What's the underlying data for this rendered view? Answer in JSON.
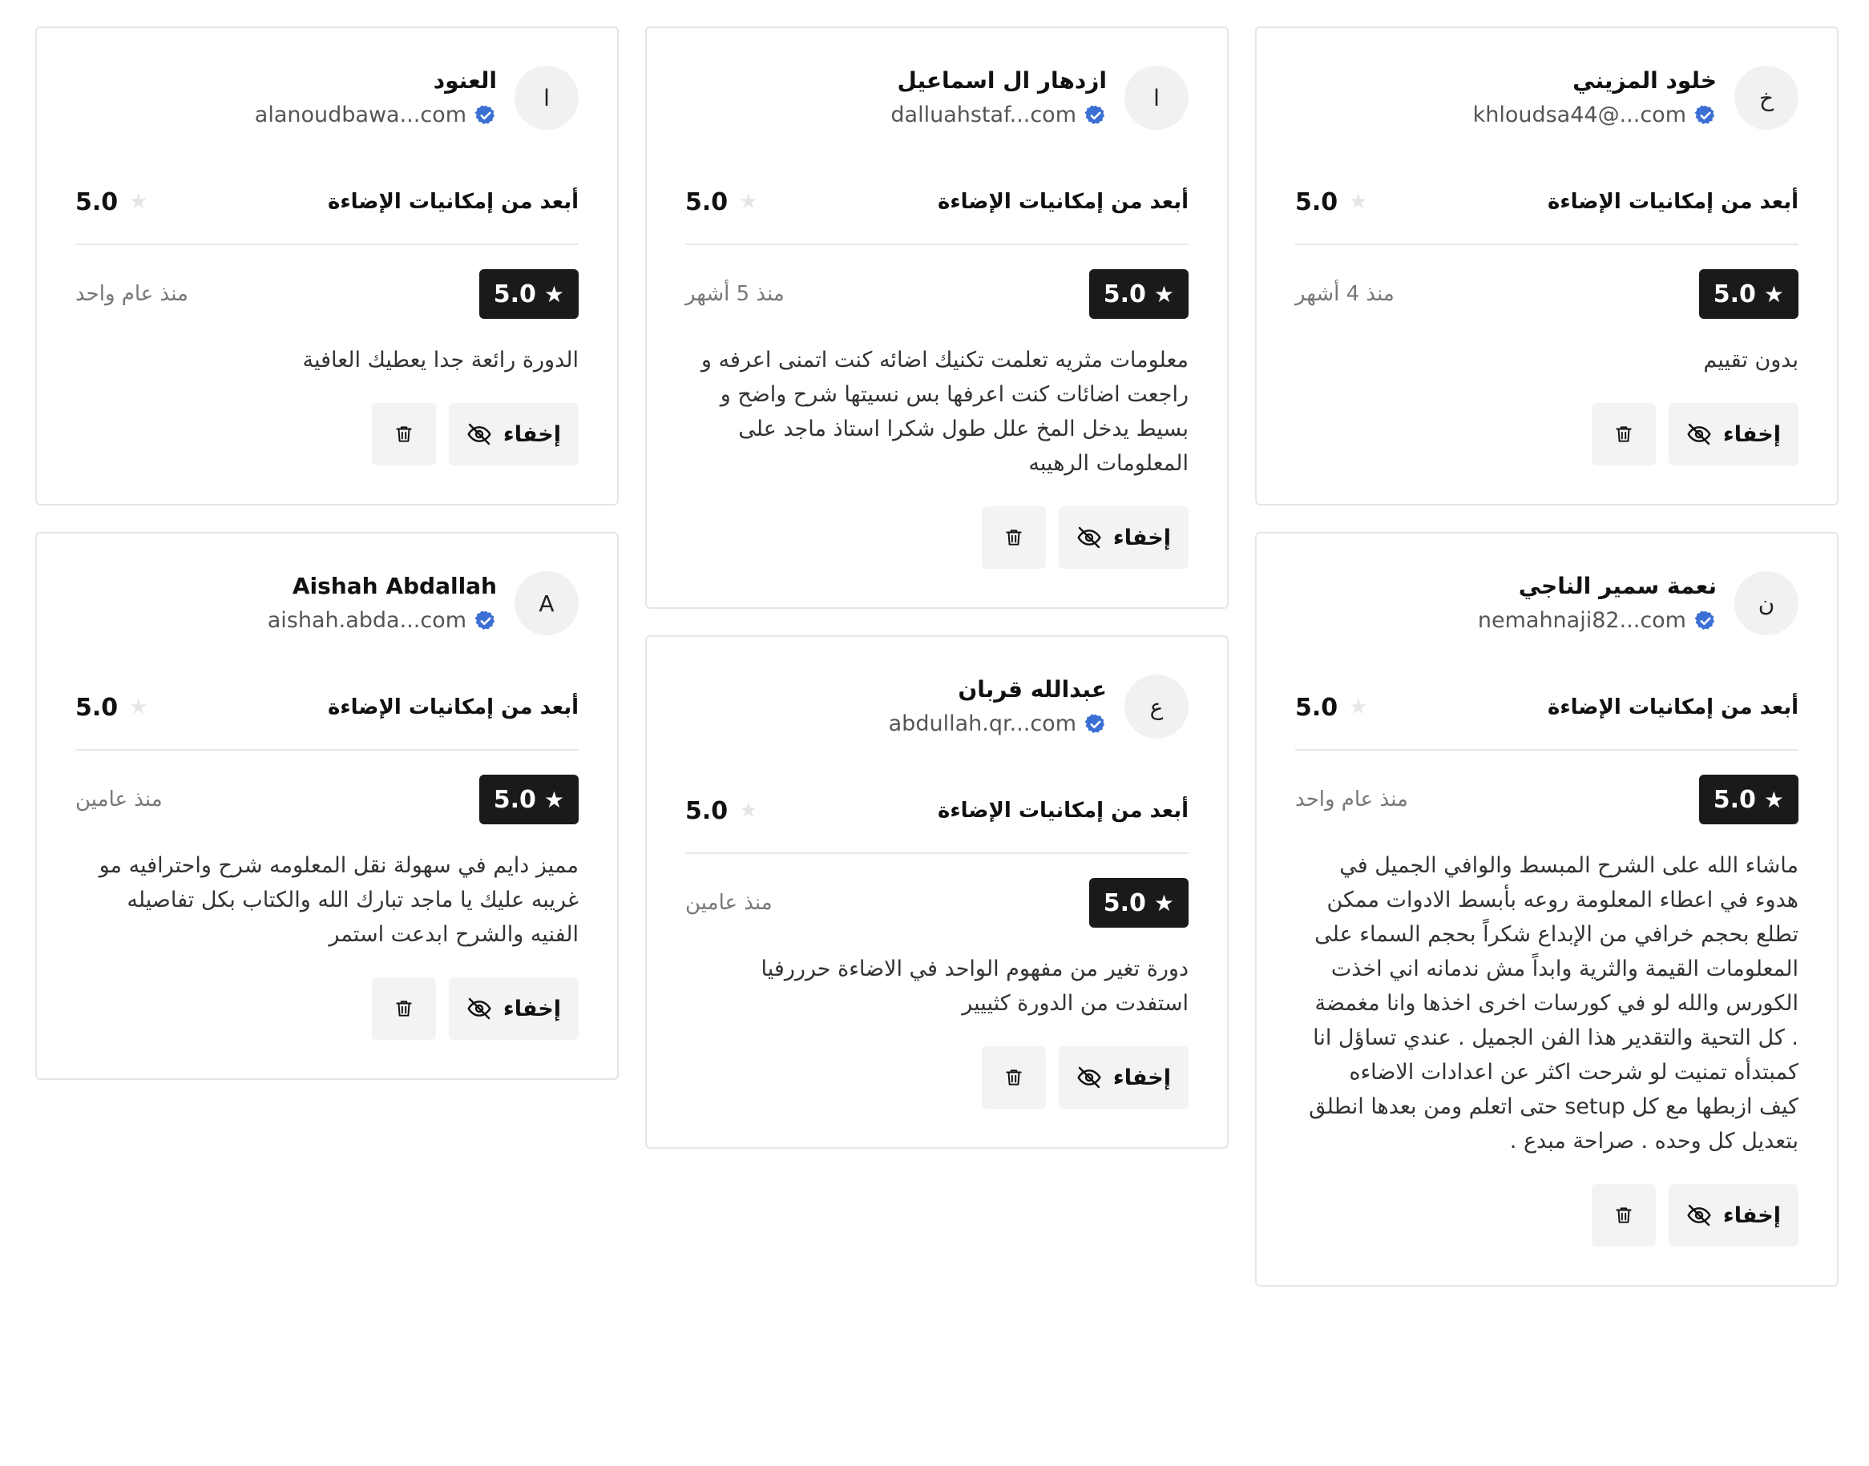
{
  "criterion_label": "أبعد من إمكانيات الإضاءة",
  "hide_label": "إخفاء",
  "colors": {
    "badge_bg": "#1a1a1a",
    "verified": "#3b6fd4",
    "button_bg": "#f3f3f3"
  },
  "icons": {
    "verified": "verified-check-icon",
    "star": "star-icon",
    "hide": "eye-off-icon",
    "delete": "trash-icon"
  },
  "reviews": [
    {
      "initial": "خ",
      "name": "خلود المزيني",
      "email": "khloudsa44@...com",
      "criterion_score": "5.0",
      "rating": "5.0",
      "time_ago": "منذ 4 أشهر",
      "comment": "بدون تقييم"
    },
    {
      "initial": "ا",
      "name": "ازدهار ال اسماعيل",
      "email": "dalluahstaf...com",
      "criterion_score": "5.0",
      "rating": "5.0",
      "time_ago": "منذ 5 أشهر",
      "comment": "معلومات مثريه تعلمت تكنيك اضائه كنت اتمنى اعرفه و راجعت اضائات كنت اعرفها بس نسيتها شرح واضح و بسيط يدخل المخ علل طول شكرا استاذ ماجد على المعلومات الرهيبه"
    },
    {
      "initial": "ا",
      "name": "العنود",
      "email": "alanoudbawa...com",
      "criterion_score": "5.0",
      "rating": "5.0",
      "time_ago": "منذ عام واحد",
      "comment": "الدورة رائعة جدا يعطيك العافية"
    },
    {
      "initial": "ن",
      "name": "نعمة سمير الناجي",
      "email": "nemahnaji82...com",
      "criterion_score": "5.0",
      "rating": "5.0",
      "time_ago": "منذ عام واحد",
      "comment": "ماشاء الله على الشرح المبسط والوافي الجميل في هدوء في اعطاء المعلومة روعه بأبسط الادوات ممكن تطلع بحجم خرافي من الإبداع شكراً بحجم السماء على المعلومات القيمة والثرية وابداً مش ندمانه اني اخذت الكورس والله لو في كورسات اخرى اخذها وانا مغمضة . كل التحية والتقدير هذا الفن الجميل . عندي تساؤل انا كمبتدأه تمنيت لو شرحت اكثر عن اعدادات الاضاءه كيف ازبطها مع كل setup حتى اتعلم ومن بعدها انطلق بتعديل كل وحده . صراحة مبدع ."
    },
    {
      "initial": "ع",
      "name": "عبدالله قربان",
      "email": "abdullah.qr...com",
      "criterion_score": "5.0",
      "rating": "5.0",
      "time_ago": "منذ عامين",
      "comment": "دورة تغير من مفهوم الواحد في الاضاءة حرررفيا استفدت من الدورة كثييير"
    },
    {
      "initial": "A",
      "name": "Aishah Abdallah",
      "email": "aishah.abda...com",
      "criterion_score": "5.0",
      "rating": "5.0",
      "time_ago": "منذ عامين",
      "comment": "مميز دايم في سهولة نقل المعلومه شرح واحترافيه مو غريبه عليك يا ماجد تبارك الله والكتاب بكل تفاصيله الفنيه والشرح ابدعت استمر"
    }
  ]
}
